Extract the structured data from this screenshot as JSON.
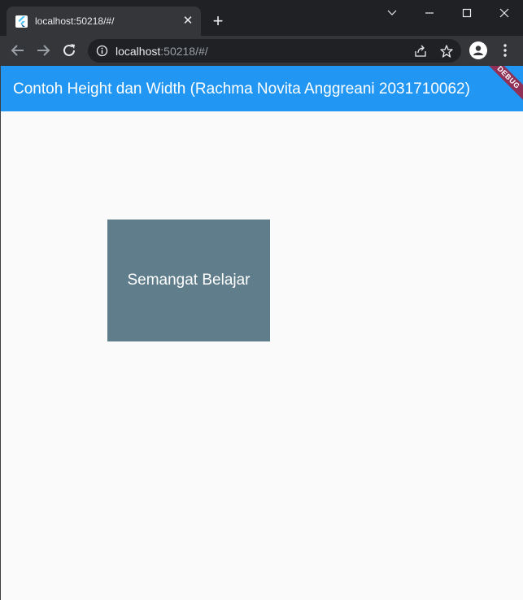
{
  "browser": {
    "tab": {
      "title": "localhost:50218/#/",
      "favicon": "flutter-icon",
      "close_glyph": "✕"
    },
    "new_tab_glyph": "+",
    "window_controls": [
      "chevron-down-icon",
      "minimize-icon",
      "maximize-icon",
      "close-icon"
    ],
    "address_bar": {
      "host": "localhost",
      "path": ":50218/#/"
    }
  },
  "app": {
    "appbar_title": "Contoh Height dan Width (Rachma Novita Anggreani 2031710062)",
    "debug_banner": "DEBUG",
    "box_text": "Semangat Belajar",
    "colors": {
      "appbar": "#2196f3",
      "box": "#607d8b",
      "background": "#fafafa",
      "debug": "#a31e3a"
    }
  }
}
